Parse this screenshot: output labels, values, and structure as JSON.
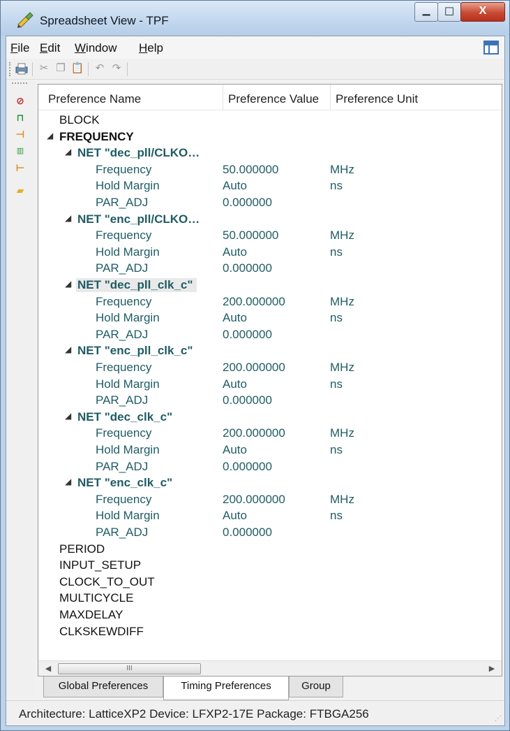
{
  "window": {
    "title": "Spreadsheet View - TPF",
    "minimize_glyph": "▁",
    "maximize_glyph": "☐",
    "close_glyph": "X"
  },
  "menu": {
    "file": "File",
    "edit": "Edit",
    "window": "Window",
    "help": "Help"
  },
  "toolbar": {
    "icons": [
      "print-icon",
      "cut-icon",
      "copy-icon",
      "paste-icon",
      "undo-icon",
      "redo-icon"
    ]
  },
  "palette": {
    "icons": [
      "clock-constraint-icon",
      "waveform-icon",
      "input-setup-icon",
      "multicycle-icon",
      "clock-to-out-icon",
      "folder-icon"
    ]
  },
  "table": {
    "columns": [
      "Preference Name",
      "Preference Value",
      "Preference Unit"
    ],
    "rows": [
      {
        "kind": "cat",
        "name": "BLOCK"
      },
      {
        "kind": "cat-open",
        "name": "FREQUENCY"
      },
      {
        "kind": "net",
        "name": "NET \"dec_pll/CLKO…"
      },
      {
        "kind": "prop",
        "name": "Frequency",
        "value": "50.000000",
        "unit": "MHz"
      },
      {
        "kind": "prop",
        "name": "Hold Margin",
        "value": "Auto",
        "unit": "ns"
      },
      {
        "kind": "prop",
        "name": "PAR_ADJ",
        "value": "0.000000",
        "unit": ""
      },
      {
        "kind": "net",
        "name": "NET \"enc_pll/CLKO…"
      },
      {
        "kind": "prop",
        "name": "Frequency",
        "value": "50.000000",
        "unit": "MHz"
      },
      {
        "kind": "prop",
        "name": "Hold Margin",
        "value": "Auto",
        "unit": "ns"
      },
      {
        "kind": "prop",
        "name": "PAR_ADJ",
        "value": "0.000000",
        "unit": ""
      },
      {
        "kind": "net-selected",
        "name": "NET \"dec_pll_clk_c\""
      },
      {
        "kind": "prop",
        "name": "Frequency",
        "value": "200.000000",
        "unit": "MHz"
      },
      {
        "kind": "prop",
        "name": "Hold Margin",
        "value": "Auto",
        "unit": "ns"
      },
      {
        "kind": "prop",
        "name": "PAR_ADJ",
        "value": "0.000000",
        "unit": ""
      },
      {
        "kind": "net",
        "name": "NET \"enc_pll_clk_c\""
      },
      {
        "kind": "prop",
        "name": "Frequency",
        "value": "200.000000",
        "unit": "MHz"
      },
      {
        "kind": "prop",
        "name": "Hold Margin",
        "value": "Auto",
        "unit": "ns"
      },
      {
        "kind": "prop",
        "name": "PAR_ADJ",
        "value": "0.000000",
        "unit": ""
      },
      {
        "kind": "net",
        "name": "NET \"dec_clk_c\""
      },
      {
        "kind": "prop",
        "name": "Frequency",
        "value": "200.000000",
        "unit": "MHz"
      },
      {
        "kind": "prop",
        "name": "Hold Margin",
        "value": "Auto",
        "unit": "ns"
      },
      {
        "kind": "prop",
        "name": "PAR_ADJ",
        "value": "0.000000",
        "unit": ""
      },
      {
        "kind": "net",
        "name": "NET \"enc_clk_c\""
      },
      {
        "kind": "prop",
        "name": "Frequency",
        "value": "200.000000",
        "unit": "MHz"
      },
      {
        "kind": "prop",
        "name": "Hold Margin",
        "value": "Auto",
        "unit": "ns"
      },
      {
        "kind": "prop",
        "name": "PAR_ADJ",
        "value": "0.000000",
        "unit": ""
      },
      {
        "kind": "cat",
        "name": "PERIOD"
      },
      {
        "kind": "cat",
        "name": "INPUT_SETUP"
      },
      {
        "kind": "cat",
        "name": "CLOCK_TO_OUT"
      },
      {
        "kind": "cat",
        "name": "MULTICYCLE"
      },
      {
        "kind": "cat",
        "name": "MAXDELAY"
      },
      {
        "kind": "cat",
        "name": "CLKSKEWDIFF"
      }
    ]
  },
  "scrollbar": {
    "thumb_grip": "III",
    "left_arrow": "◀",
    "right_arrow": "▶"
  },
  "tabs": [
    "Global Preferences",
    "Timing Preferences",
    "Group"
  ],
  "active_tab": "Timing Preferences",
  "status": "Architecture: LatticeXP2  Device: LFXP2-17E  Package: FTBGA256",
  "colors": {
    "net_text": "#1f5c64",
    "title_bar": "#c2d7ee",
    "close_button": "#c84a32"
  }
}
